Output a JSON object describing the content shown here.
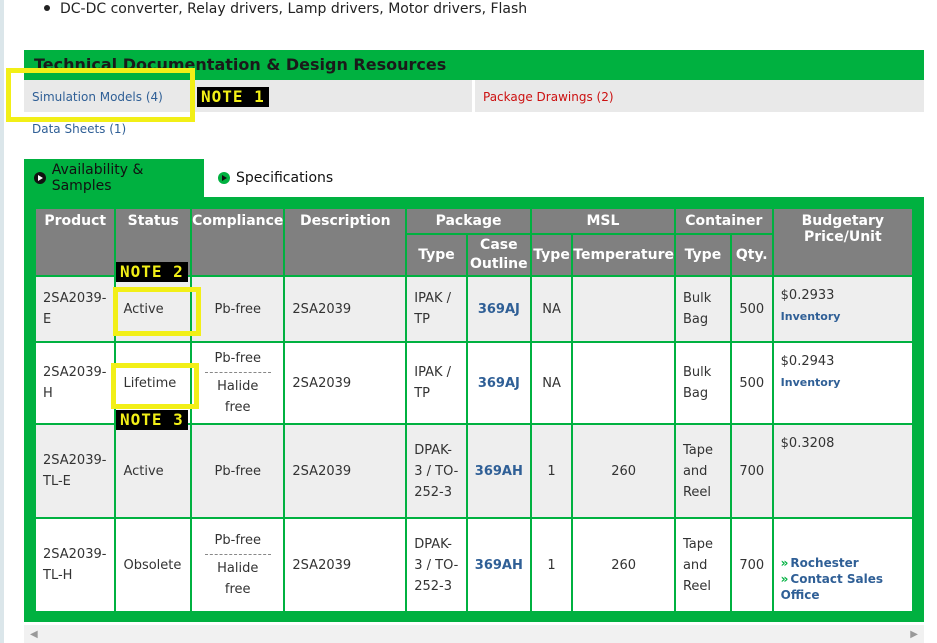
{
  "bullet": "DC-DC converter, Relay drivers, Lamp drivers, Motor drivers, Flash",
  "tech_docs": {
    "title": "Technical Documentation & Design Resources",
    "simulation_models": "Simulation Models (4)",
    "package_drawings": "Package Drawings (2)",
    "data_sheets": "Data Sheets (1)"
  },
  "tabs": {
    "availability": "Availability & Samples",
    "specifications": "Specifications"
  },
  "table": {
    "headers": {
      "product": "Product",
      "status": "Status",
      "compliance": "Compliance",
      "description": "Description",
      "package": "Package",
      "msl": "MSL",
      "container": "Container",
      "price": "Budgetary Price/Unit",
      "pkg_type": "Type",
      "case_outline": "Case Outline",
      "msl_type": "Type",
      "temperature": "Temperature",
      "cont_type": "Type",
      "qty": "Qty."
    },
    "rows": [
      {
        "product": "2SA2039-E",
        "status": "Active",
        "compliance": [
          "Pb-free"
        ],
        "description": "2SA2039",
        "pkg_type": "IPAK / TP",
        "case_outline": "369AJ",
        "msl_type": "NA",
        "temperature": "",
        "cont_type": "Bulk Bag",
        "qty": "500",
        "price": "$0.2933",
        "price_link": "Inventory"
      },
      {
        "product": "2SA2039-H",
        "status": "Lifetime",
        "compliance": [
          "Pb-free",
          "Halide free"
        ],
        "description": "2SA2039",
        "pkg_type": "IPAK / TP",
        "case_outline": "369AJ",
        "msl_type": "NA",
        "temperature": "",
        "cont_type": "Bulk Bag",
        "qty": "500",
        "price": "$0.2943",
        "price_link": "Inventory"
      },
      {
        "product": "2SA2039-TL-E",
        "status": "Active",
        "compliance": [
          "Pb-free"
        ],
        "description": "2SA2039",
        "pkg_type": "DPAK-3 / TO-252-3",
        "case_outline": "369AH",
        "msl_type": "1",
        "temperature": "260",
        "cont_type": "Tape and Reel",
        "qty": "700",
        "price": "$0.3208",
        "price_link": ""
      },
      {
        "product": "2SA2039-TL-H",
        "status": "Obsolete",
        "compliance": [
          "Pb-free",
          "Halide free"
        ],
        "description": "2SA2039",
        "pkg_type": "DPAK-3 / TO-252-3",
        "case_outline": "369AH",
        "msl_type": "1",
        "temperature": "260",
        "cont_type": "Tape and Reel",
        "qty": "700",
        "price": "",
        "links": [
          "Rochester",
          "Contact Sales Office"
        ]
      }
    ]
  },
  "notes": {
    "note1": "NOTE 1",
    "note2": "NOTE 2",
    "note3": "NOTE 3"
  },
  "colors": {
    "green": "#00b140",
    "highlight": "#f2ef17",
    "link": "#2f5f96",
    "red_link": "#cc1111",
    "header_gray": "#808080"
  },
  "icons": {
    "tab_active": "play-circle-icon",
    "tab_inactive": "play-circle-icon",
    "link_arrow": "double-chevron-right-icon",
    "scroll_left": "arrow-left-icon",
    "scroll_right": "arrow-right-icon"
  }
}
